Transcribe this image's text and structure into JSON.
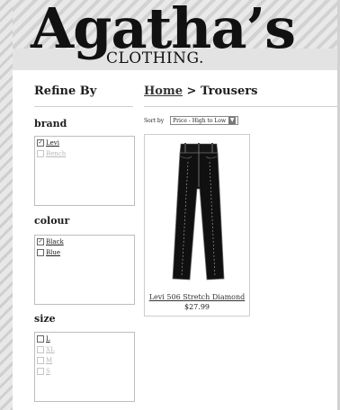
{
  "site": {
    "logo": "Agatha’s",
    "tagline": "CLOTHING."
  },
  "sidebar": {
    "title": "Refine By",
    "facets": [
      {
        "title": "brand",
        "options": [
          {
            "label": "Levi",
            "checked": true,
            "enabled": true
          },
          {
            "label": "Bench",
            "checked": false,
            "enabled": false
          }
        ]
      },
      {
        "title": "colour",
        "options": [
          {
            "label": "Black",
            "checked": true,
            "enabled": true
          },
          {
            "label": "Blue",
            "checked": false,
            "enabled": true
          }
        ]
      },
      {
        "title": "size",
        "options": [
          {
            "label": "L",
            "checked": false,
            "enabled": true
          },
          {
            "label": "XL",
            "checked": false,
            "enabled": false
          },
          {
            "label": "M",
            "checked": false,
            "enabled": false
          },
          {
            "label": "S",
            "checked": false,
            "enabled": false
          }
        ]
      }
    ]
  },
  "breadcrumb": {
    "home": "Home",
    "separator": " > ",
    "current": "Trousers"
  },
  "sort": {
    "label": "Sort by",
    "selected": "Price - High to Low"
  },
  "products": [
    {
      "name": "Levi 506 Stretch Diamond",
      "price": "$27.99",
      "image_icon": "jeans-image"
    }
  ]
}
